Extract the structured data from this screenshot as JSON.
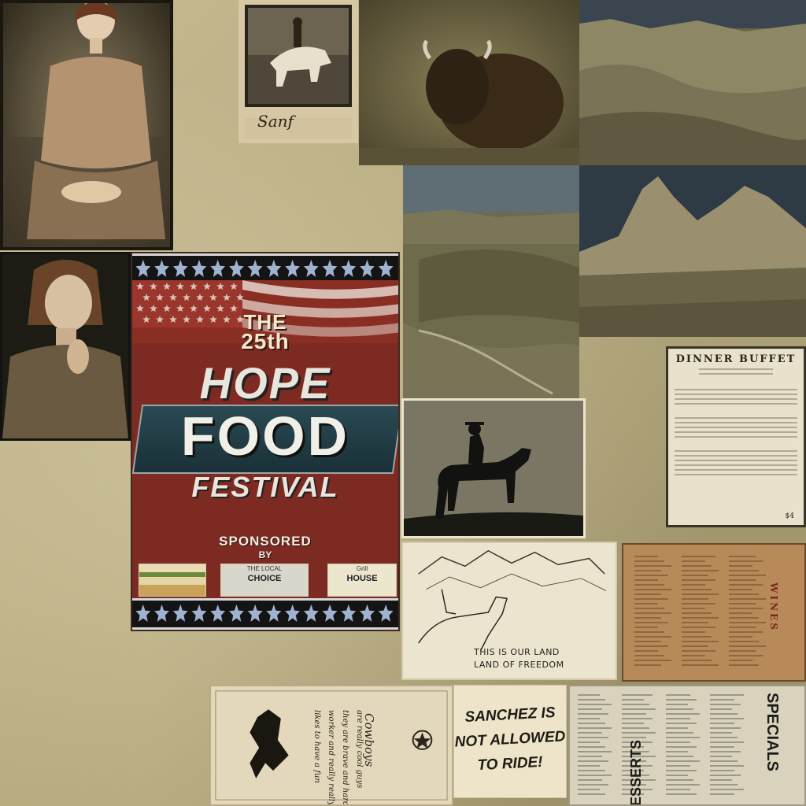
{
  "photos": {
    "woman_portrait_1": "vintage portrait of seated woman",
    "rodeo_photo": "bronc rider photo",
    "bison": "bison",
    "hills": "badlands hills",
    "woman_portrait_2": "vintage portrait of woman",
    "badlands": "badlands valley",
    "peaks": "badlands peaks",
    "rider_silhouette": "cowboy on horse silhouette"
  },
  "rodeo_signature": "Sanf",
  "poster": {
    "line1": "THE",
    "line2": "25th",
    "hope": "HOPE",
    "food": "FOOD",
    "festival": "FESTIVAL",
    "sponsored": "SPONSORED",
    "by": "BY",
    "sponsors": [
      {
        "top": "",
        "main": ""
      },
      {
        "top": "THE LOCAL",
        "main": "CHOICE"
      },
      {
        "top": "Grill",
        "main": "HOUSE"
      }
    ],
    "colors": {
      "red": "#7d2a22",
      "band": "#141414",
      "star": "#9fb3d1"
    }
  },
  "buffet_menu": {
    "title": "DINNER BUFFET",
    "price": "$4"
  },
  "freedom_card": {
    "line1": "THIS IS OUR LAND",
    "line2": "LAND OF FREEDOM"
  },
  "wines_menu": {
    "label": "WINES"
  },
  "cowboys_note": {
    "title": "Cowboys",
    "lines": [
      "are really cool guys",
      "they are brave and hard",
      "worker and really really",
      "likes to have a fun"
    ]
  },
  "sanchez_sign": {
    "lines": [
      "SANCHEZ IS",
      "NOT ALLOWED",
      "TO RIDE!"
    ]
  },
  "newspaper": {
    "specials": "SPECIALS",
    "desserts": "DESSERTS"
  }
}
